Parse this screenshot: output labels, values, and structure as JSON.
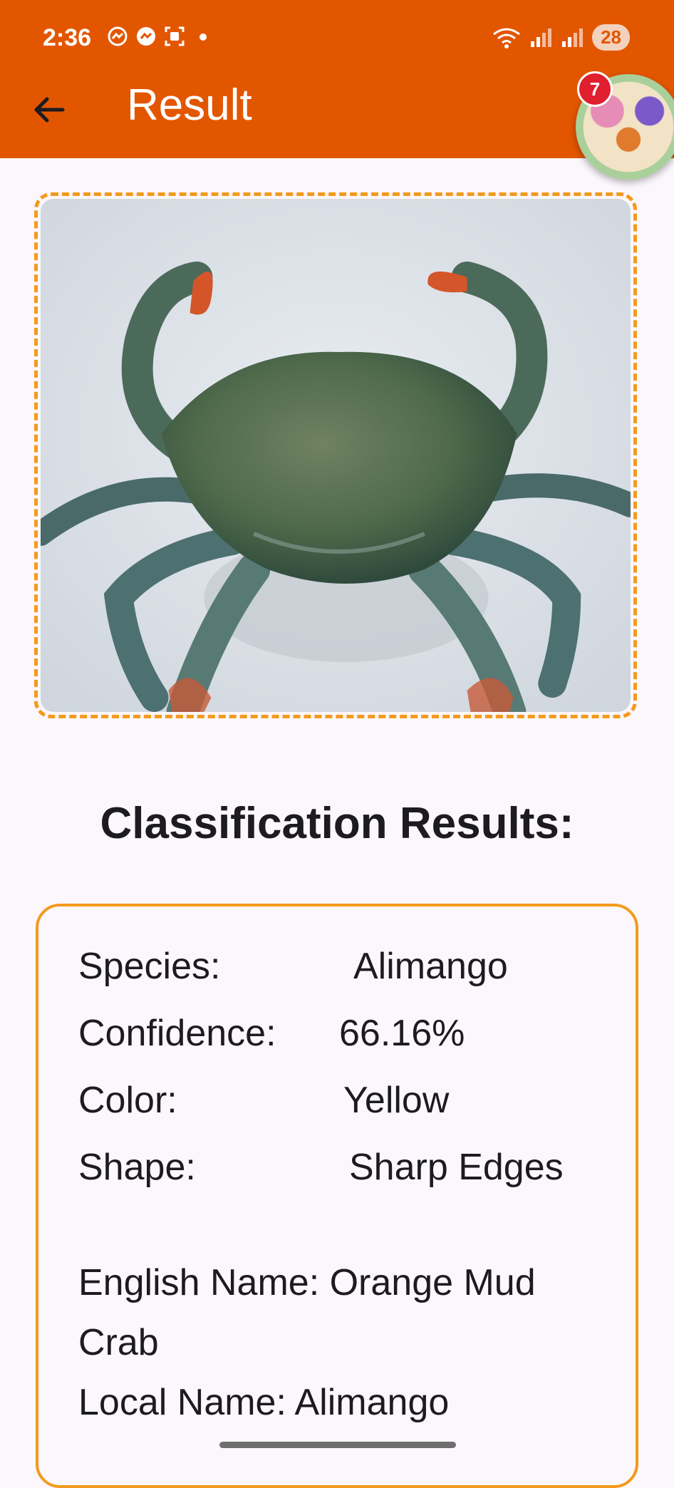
{
  "status_bar": {
    "time": "2:36",
    "battery": "28",
    "left_icons": [
      "messenger-outline-icon",
      "messenger-icon",
      "screenshot-icon",
      "dot-icon"
    ],
    "right_icons": [
      "wifi-icon",
      "signal-icon",
      "signal-icon"
    ]
  },
  "app_bar": {
    "title": "Result",
    "back_icon": "back-arrow-icon"
  },
  "chat_head": {
    "badge": "7"
  },
  "colors": {
    "primary": "#e35600",
    "accent_border": "#f39a1c",
    "background": "#fcf7fc"
  },
  "main": {
    "heading": "Classification Results:",
    "results": [
      {
        "label": "Species:",
        "value": "Alimango"
      },
      {
        "label": "Confidence:",
        "value": "66.16%"
      },
      {
        "label": "Color:",
        "value": "Yellow"
      },
      {
        "label": "Shape:",
        "value": "Sharp Edges"
      }
    ],
    "english_name": "English Name: Orange Mud Crab",
    "local_name": "Local Name: Alimango"
  }
}
